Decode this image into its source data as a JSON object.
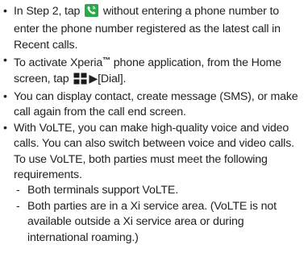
{
  "bullets": [
    {
      "before": "In Step 2, tap",
      "icon": "phone-call-icon",
      "after": "without entering a phone number to enter the phone number registered as the latest call in Recent calls."
    },
    {
      "before": "To activate Xperia",
      "tm": "™",
      "middle": " phone application, from the Home screen, tap",
      "icon": "apps-grid-icon",
      "arrow": "▶",
      "after": "[Dial]."
    },
    {
      "text": "You can display contact, create message (SMS), or make call again from the call end screen."
    },
    {
      "text": "With VoLTE, you can make high-quality voice and video calls. You can also switch between voice and video calls.",
      "para": "To use VoLTE, both parties must meet the following requirements.",
      "sub": [
        "Both terminals support VoLTE.",
        "Both parties are in a Xi service area. (VoLTE is not available outside a Xi service area or during international roaming.)"
      ]
    }
  ],
  "bullet_char": "•",
  "dash_char": "-",
  "colors": {
    "text": "#222222",
    "phone_icon_bg": "#2aa84a",
    "grid_icon": "#1a1a1a"
  }
}
